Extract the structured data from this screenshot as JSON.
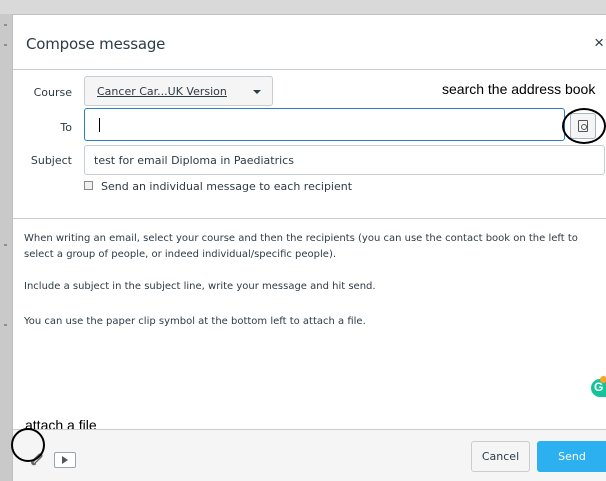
{
  "dialog": {
    "title": "Compose message",
    "close_label": "×"
  },
  "form": {
    "course_label": "Course",
    "course_value": "Cancer Car...UK Version",
    "to_label": "To",
    "to_value": "",
    "subject_label": "Subject",
    "subject_value": "test for email Diploma in Paediatrics",
    "individual_checkbox_label": "Send an individual message to each recipient",
    "individual_checkbox_checked": false
  },
  "annotations": {
    "search_address_book": "search the address book",
    "attach_file": "attach a file"
  },
  "message": {
    "paragraph1": "When writing an email, select your course and then the recipients (you can use the contact book on the left to select a group of people, or indeed individual/specific people).",
    "paragraph2": "Include a subject in the subject line, write your message and hit send.",
    "paragraph3": "You can use the paper clip symbol at the bottom left to attach a file."
  },
  "footer": {
    "cancel_label": "Cancel",
    "send_label": "Send"
  },
  "icons": {
    "close": "close-icon",
    "address_book": "address-book-icon",
    "caret": "caret-down-icon",
    "attach": "paperclip-icon",
    "media": "media-icon",
    "grammarly": "grammarly-icon"
  },
  "colors": {
    "send": "#2cb0f0",
    "focus_border": "#2d7ec5",
    "grammarly": "#15c39a"
  }
}
